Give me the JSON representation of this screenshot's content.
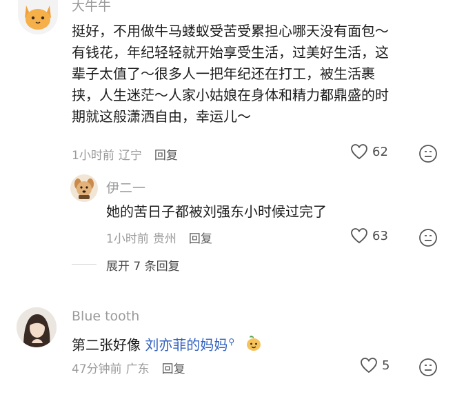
{
  "comments": [
    {
      "username": "大牛牛",
      "text_lines": [
        "挺好，不用做牛马蝼蚁受苦受累担心哪天没有面包～",
        "有钱花，年纪轻轻就开始享受生活，过美好生活，这",
        "辈子太值了～很多人一把年纪还在打工，被生活裹",
        "挟，人生迷茫～人家小姑娘在身体和精力都鼎盛的时",
        "期就这般潇洒自由，幸运儿～"
      ],
      "time": "1小时前",
      "location": "辽宁",
      "reply_label": "回复",
      "likes": "62",
      "avatar_icon": "cat-face-icon"
    },
    {
      "username": "伊二一",
      "text": "她的苦日子都被刘强东小时候过完了",
      "time": "1小时前",
      "location": "贵州",
      "reply_label": "回复",
      "likes": "63",
      "avatar_icon": "dog-avatar-icon"
    },
    {
      "username": "Blue tooth",
      "text_prefix": "第二张好像 ",
      "mention": "刘亦菲的妈妈",
      "mention_icon": "search-icon",
      "emoji": "peach-emoji-icon",
      "time": "47分钟前",
      "location": "广东",
      "reply_label": "回复",
      "likes": "5",
      "avatar_icon": "woman-avatar-icon"
    }
  ],
  "expand": {
    "label": "展开 7 条回复"
  },
  "colors": {
    "meta": "#9a9a9a",
    "mention": "#2f5fbf",
    "text": "#1c1c1c"
  }
}
